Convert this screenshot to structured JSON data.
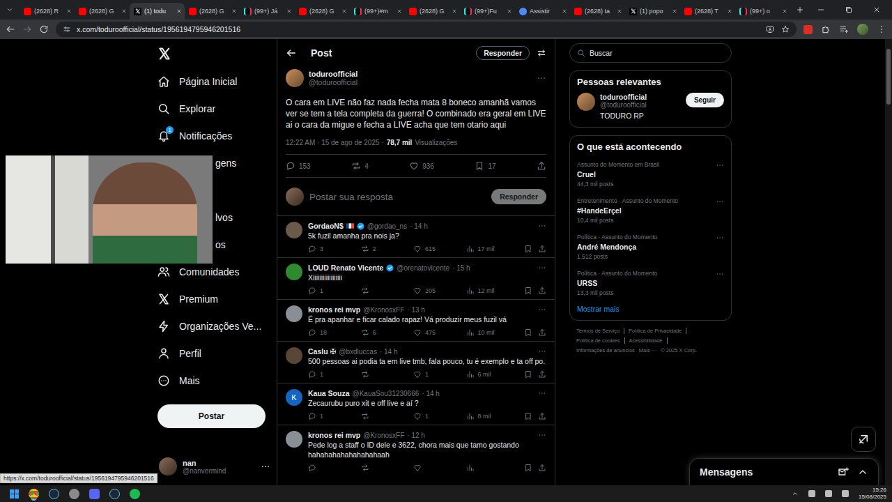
{
  "browser": {
    "tabs": [
      {
        "label": "(2628) R",
        "kind": "youtube",
        "selected": false
      },
      {
        "label": "(2628) G",
        "kind": "youtube",
        "selected": false
      },
      {
        "label": "(1) todu",
        "kind": "x",
        "selected": true
      },
      {
        "label": "(2628) G",
        "kind": "youtube",
        "selected": false
      },
      {
        "label": "(99+) Já",
        "kind": "tiktok",
        "selected": false
      },
      {
        "label": "(2628) G",
        "kind": "youtube",
        "selected": false
      },
      {
        "label": "(99+)#m",
        "kind": "tiktok",
        "selected": false
      },
      {
        "label": "(2628) G",
        "kind": "youtube",
        "selected": false
      },
      {
        "label": "(99+)Fu",
        "kind": "tiktok",
        "selected": false
      },
      {
        "label": "Assistir",
        "kind": "web",
        "selected": false
      },
      {
        "label": "(2628) ta",
        "kind": "youtube",
        "selected": false
      },
      {
        "label": "(1) popo",
        "kind": "x",
        "selected": false
      },
      {
        "label": "(2628) T",
        "kind": "youtube",
        "selected": false
      },
      {
        "label": "(99+) o",
        "kind": "tiktok",
        "selected": false
      }
    ],
    "url": "x.com/toduroofficial/status/1956194795946201516"
  },
  "sidebar": {
    "items": [
      {
        "label": "Página Inicial",
        "badge": "",
        "obscured": false
      },
      {
        "label": "Explorar",
        "badge": "",
        "obscured": false
      },
      {
        "label": "Notificações",
        "badge": "1",
        "obscured": false
      },
      {
        "label": "gens",
        "badge": "",
        "obscured": true
      },
      {
        "label": "",
        "badge": "",
        "obscured": true
      },
      {
        "label": "lvos",
        "badge": "",
        "obscured": true
      },
      {
        "label": "os",
        "badge": "",
        "obscured": true
      },
      {
        "label": "Comunidades",
        "badge": "",
        "obscured": false
      },
      {
        "label": "Premium",
        "badge": "",
        "obscured": false
      },
      {
        "label": "Organizações Ve...",
        "badge": "",
        "obscured": false
      },
      {
        "label": "Perfil",
        "badge": "",
        "obscured": false
      },
      {
        "label": "Mais",
        "badge": "",
        "obscured": false
      }
    ],
    "post_button": "Postar",
    "account": {
      "name": "nan",
      "handle": "@nanvermind"
    }
  },
  "post": {
    "header": "Post",
    "reply_button": "Responder",
    "author": {
      "name": "toduroofficial",
      "handle": "@toduroofficial"
    },
    "text": "O cara em LIVE não faz nada fecha mata 8 boneco amanhã vamos ver se tem a tela completa da guerra! O combinado era geral em LIVE ai o cara da migue e fecha a LIVE acha que tem otario aqui",
    "time": "12:22 AM · 15 de ago de 2025 ·",
    "views": "78,7 mil",
    "views_label": "Visualizações",
    "stats": {
      "replies": "153",
      "reposts": "4",
      "likes": "936",
      "bookmarks": "17"
    }
  },
  "compose": {
    "placeholder": "Postar sua resposta",
    "button": "Responder",
    "disabled": true
  },
  "replies": [
    {
      "name": "GordaoN$",
      "flag": true,
      "verified": true,
      "handle": "@gordao_ns",
      "age": "· 14 h",
      "text": "5k fuzil amanha pra nois ja?",
      "replies": "3",
      "reposts": "2",
      "likes": "615",
      "views": "17 mil",
      "color": "#6b5a4a",
      "initial": ""
    },
    {
      "name": "LOUD Renato Vicente",
      "flag": false,
      "verified": true,
      "handle": "@orenatovicente",
      "age": "· 15 h",
      "text": "Xiiiiiiiiiiiiiiiiii",
      "replies": "1",
      "reposts": "",
      "likes": "205",
      "views": "12 mil",
      "color": "#2f8a2f",
      "initial": ""
    },
    {
      "name": "kronos rei mvp",
      "flag": false,
      "verified": false,
      "handle": "@KronosxFF",
      "age": "· 13 h",
      "text": "É pra apanhar e ficar calado rapaz! Vá produzir meus fuzil vá",
      "replies": "18",
      "reposts": "6",
      "likes": "475",
      "views": "10 mil",
      "color": "#8a8f96",
      "initial": ""
    },
    {
      "name": "Caslu ✠",
      "flag": false,
      "verified": false,
      "handle": "@bxdluccas",
      "age": "· 14 h",
      "text": "500 pessoas ai podia ta em live tmb, fala pouco, tu é exemplo e ta off po.",
      "replies": "1",
      "reposts": "",
      "likes": "1",
      "views": "6 mil",
      "color": "#5a4636",
      "initial": ""
    },
    {
      "name": "Kaua Souza",
      "flag": false,
      "verified": false,
      "handle": "@KauaSou31230666",
      "age": "· 14 h",
      "text": "Zecaurubu puro xit e off live e aí ?",
      "replies": "1",
      "reposts": "",
      "likes": "1",
      "views": "8 mil",
      "color": "#1565c0",
      "initial": "K"
    },
    {
      "name": "kronos rei mvp",
      "flag": false,
      "verified": false,
      "handle": "@KronosxFF",
      "age": "· 12 h",
      "text": "Pede log a staff o ID dele e 3622, chora mais que tamo gostando hahahahahahahahahaah",
      "replies": "",
      "reposts": "",
      "likes": "",
      "views": "",
      "color": "#8a8f96",
      "initial": ""
    }
  ],
  "search": {
    "placeholder": "Buscar"
  },
  "relevant": {
    "title": "Pessoas relevantes",
    "people": [
      {
        "name": "toduroofficial",
        "handle": "@toduroofficial",
        "bio": "TODURO RP",
        "button": "Seguir"
      }
    ]
  },
  "trends": {
    "title": "O que está acontecendo",
    "items": [
      {
        "category": "Assunto do Momento em Brasil",
        "title": "Cruel",
        "posts": "44,3 mil posts"
      },
      {
        "category": "Entretenimento · Assunto do Momento",
        "title": "#HandeErçel",
        "posts": "10,4 mil posts"
      },
      {
        "category": "Política · Assunto do Momento",
        "title": "André Mendonça",
        "posts": "1.512 posts"
      },
      {
        "category": "Política · Assunto do Momento",
        "title": "URSS",
        "posts": "13,3 mil posts"
      }
    ],
    "more": "Mostrar mais"
  },
  "footer": {
    "links": [
      {
        "label": "Termos de Serviço",
        "separator": true
      },
      {
        "label": "Política de Privacidade",
        "separator": true
      },
      {
        "label": "Política de cookies",
        "separator": true
      },
      {
        "label": "Acessibilidade",
        "separator": true
      },
      {
        "label": "Informações de anúncios",
        "separator": false
      },
      {
        "label": "Mais ···",
        "separator": false
      },
      {
        "label": "© 2025 X Corp.",
        "separator": false
      }
    ]
  },
  "messages_drawer": {
    "title": "Mensagens"
  },
  "status_url": "https://x.com/toduroofficial/status/1956194795946201516",
  "taskbar": {
    "time": "15:26",
    "date": "15/08/2025"
  }
}
